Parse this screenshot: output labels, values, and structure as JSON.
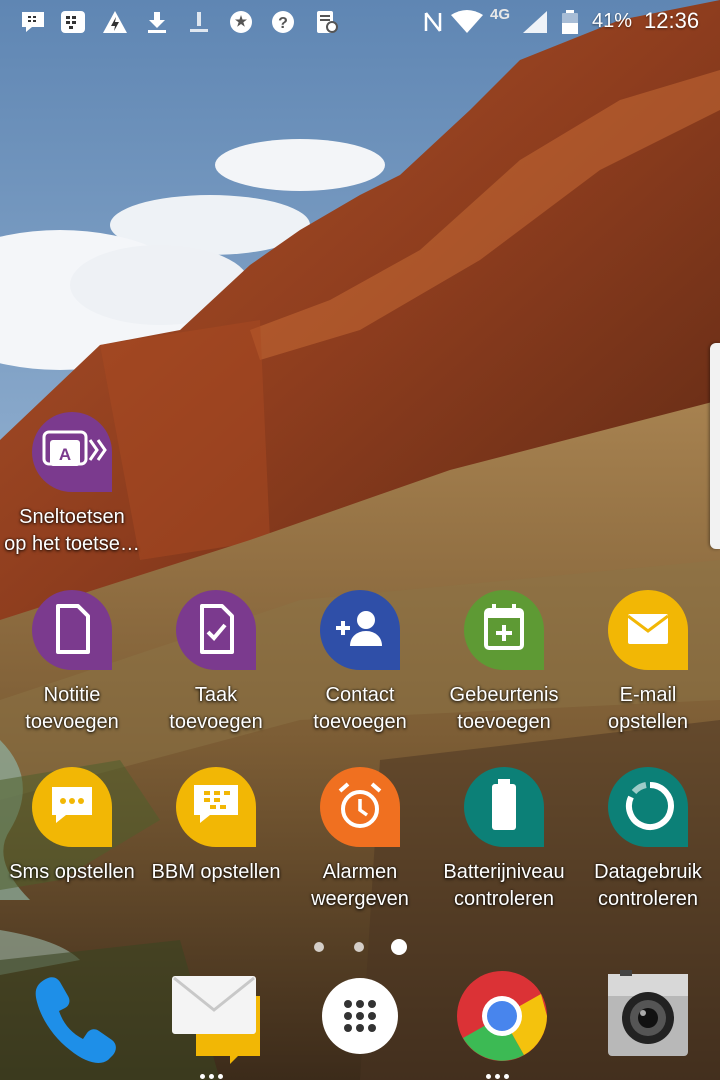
{
  "status_bar": {
    "carrier_label": "4G",
    "battery_percent": "41%",
    "time": "12:36",
    "icons": [
      "bbm-notification-icon",
      "blackberry-hub-icon",
      "power-saver-icon",
      "download-icon",
      "silent-icon",
      "accessibility-icon",
      "help-icon",
      "clipboard-icon",
      "nfc-icon",
      "wifi-icon",
      "signal-icon",
      "battery-icon"
    ]
  },
  "shortcuts": [
    {
      "label_line1": "Sneltoetsen",
      "label_line2": "op het toetse…",
      "icon": "keyboard-shortcuts-icon",
      "color": "#7b3a8e"
    },
    {
      "label_line1": "Notitie",
      "label_line2": "toevoegen",
      "icon": "note-icon",
      "color": "#7b3a8e"
    },
    {
      "label_line1": "Taak",
      "label_line2": "toevoegen",
      "icon": "task-icon",
      "color": "#7b3a8e"
    },
    {
      "label_line1": "Contact",
      "label_line2": "toevoegen",
      "icon": "add-contact-icon",
      "color": "#2f4fa8"
    },
    {
      "label_line1": "Gebeurtenis",
      "label_line2": "toevoegen",
      "icon": "calendar-event-icon",
      "color": "#5e9a34"
    },
    {
      "label_line1": "E-mail",
      "label_line2": "opstellen",
      "icon": "email-icon",
      "color": "#f2b705"
    },
    {
      "label_line1": "Sms opstellen",
      "label_line2": "",
      "icon": "sms-icon",
      "color": "#f2b705"
    },
    {
      "label_line1": "BBM opstellen",
      "label_line2": "",
      "icon": "bbm-icon",
      "color": "#f2b705"
    },
    {
      "label_line1": "Alarmen",
      "label_line2": "weergeven",
      "icon": "alarm-icon",
      "color": "#f07020"
    },
    {
      "label_line1": "Batterijniveau",
      "label_line2": "controleren",
      "icon": "battery-level-icon",
      "color": "#0c8077"
    },
    {
      "label_line1": "Datagebruik",
      "label_line2": "controleren",
      "icon": "data-usage-icon",
      "color": "#0c8077"
    }
  ],
  "pager": {
    "pages": 3,
    "active_page": 3
  },
  "dock": [
    {
      "name": "phone-app",
      "icon": "phone-icon"
    },
    {
      "name": "hub-app",
      "icon": "envelope-icon"
    },
    {
      "name": "app-drawer",
      "icon": "app-drawer-icon"
    },
    {
      "name": "chrome-app",
      "icon": "chrome-icon"
    },
    {
      "name": "camera-app",
      "icon": "camera-icon"
    }
  ]
}
